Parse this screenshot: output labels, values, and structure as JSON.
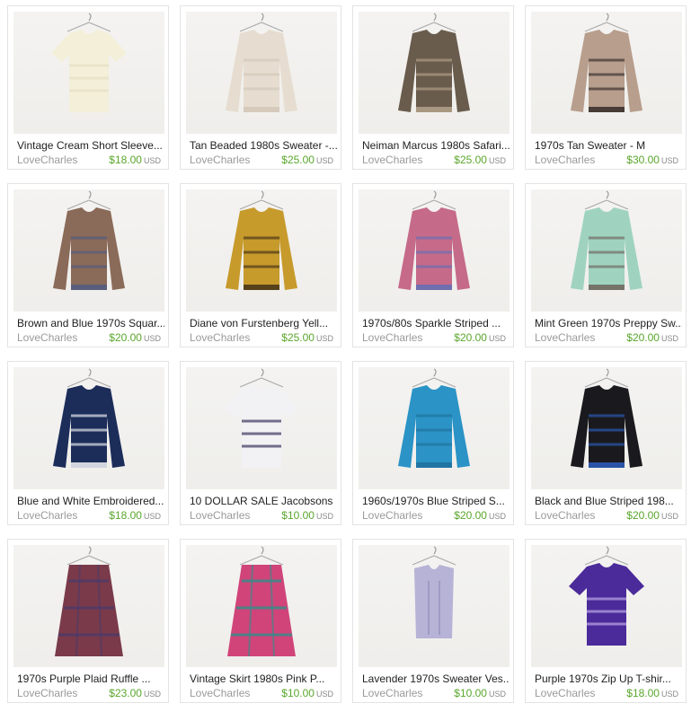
{
  "listings": [
    {
      "title": "Vintage Cream Short Sleeve...",
      "shop": "LoveCharles",
      "price": "$18.00",
      "currency": "USD",
      "image": "cream-short-sleeve-sweater",
      "colors": [
        "#f3efd9",
        "#e7e0c6"
      ]
    },
    {
      "title": "Tan Beaded 1980s Sweater -...",
      "shop": "LoveCharles",
      "price": "$25.00",
      "currency": "USD",
      "image": "tan-beaded-sweater",
      "colors": [
        "#e6ddd0",
        "#d2c6b6"
      ]
    },
    {
      "title": "Neiman Marcus 1980s Safari...",
      "shop": "LoveCharles",
      "price": "$25.00",
      "currency": "USD",
      "image": "safari-print-sweater",
      "colors": [
        "#6a5c4d",
        "#b9a88f"
      ]
    },
    {
      "title": "1970s Tan Sweater - M",
      "shop": "LoveCharles",
      "price": "$30.00",
      "currency": "USD",
      "image": "tan-sweater",
      "colors": [
        "#b89e8d",
        "#2a2322"
      ]
    },
    {
      "title": "Brown and Blue 1970s Squar...",
      "shop": "LoveCharles",
      "price": "$20.00",
      "currency": "USD",
      "image": "brown-blue-striped-sweater",
      "colors": [
        "#8a6a58",
        "#4b5b86"
      ]
    },
    {
      "title": "Diane von Furstenberg Yell...",
      "shop": "LoveCharles",
      "price": "$25.00",
      "currency": "USD",
      "image": "yellow-print-blouse",
      "colors": [
        "#c79a2c",
        "#3a2a16"
      ]
    },
    {
      "title": "1970s/80s Sparkle Striped ...",
      "shop": "LoveCharles",
      "price": "$20.00",
      "currency": "USD",
      "image": "sparkle-striped-sweater",
      "colors": [
        "#c66a8a",
        "#5a6fb6"
      ]
    },
    {
      "title": "Mint Green 1970s Preppy Sw...",
      "shop": "LoveCharles",
      "price": "$20.00",
      "currency": "USD",
      "image": "mint-green-sweater",
      "colors": [
        "#9fd3c0",
        "#6b5c54"
      ]
    },
    {
      "title": "Blue and White Embroidered...",
      "shop": "LoveCharles",
      "price": "$18.00",
      "currency": "USD",
      "image": "embroidered-blue-top",
      "colors": [
        "#1c2d5a",
        "#ffffff"
      ]
    },
    {
      "title": "10 DOLLAR SALE Jacobsons",
      "shop": "LoveCharles",
      "price": "$10.00",
      "currency": "USD",
      "image": "striped-tshirt",
      "colors": [
        "#f2f2f4",
        "#3b3660"
      ]
    },
    {
      "title": "1960s/1970s Blue Striped S...",
      "shop": "LoveCharles",
      "price": "$20.00",
      "currency": "USD",
      "image": "blue-cardigan",
      "colors": [
        "#2b93c6",
        "#1f6e98"
      ]
    },
    {
      "title": "Black and Blue Striped 198...",
      "shop": "LoveCharles",
      "price": "$20.00",
      "currency": "USD",
      "image": "black-blue-sweater",
      "colors": [
        "#1a1a1e",
        "#2f63c8"
      ]
    },
    {
      "title": "1970s Purple Plaid Ruffle ...",
      "shop": "LoveCharles",
      "price": "$23.00",
      "currency": "USD",
      "image": "plaid-ruffle-skirt",
      "colors": [
        "#7a3a4a",
        "#4b3a6a"
      ]
    },
    {
      "title": "Vintage Skirt 1980s Pink P...",
      "shop": "LoveCharles",
      "price": "$10.00",
      "currency": "USD",
      "image": "pink-plaid-skirt",
      "colors": [
        "#d0447a",
        "#2f8f8a"
      ]
    },
    {
      "title": "Lavender 1970s Sweater Ves...",
      "shop": "LoveCharles",
      "price": "$10.00",
      "currency": "USD",
      "image": "lavender-sweater-vest",
      "colors": [
        "#b6b3d6",
        "#9e9bc4"
      ]
    },
    {
      "title": "Purple 1970s Zip Up T-shir...",
      "shop": "LoveCharles",
      "price": "$18.00",
      "currency": "USD",
      "image": "purple-zip-tshirt",
      "colors": [
        "#4b2a9a",
        "#b9a6e6"
      ]
    }
  ]
}
